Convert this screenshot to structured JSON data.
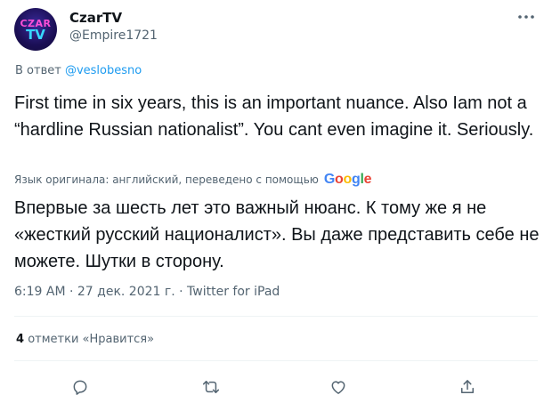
{
  "author": {
    "avatar_text_top": "CZAR",
    "avatar_text_bottom": "TV",
    "display_name": "CzarTV",
    "handle": "@Empire1721"
  },
  "reply": {
    "prefix": "В ответ",
    "mention": "@veslobesno"
  },
  "tweet": {
    "text": "First time in six years, this is an important nuance. Also Iam not a “hardline Russian nationalist”. You cant even imagine it. Seriously.",
    "translation_note": "Язык оригинала: английский, переведено с помощью",
    "translation_provider": "Google",
    "translated_text": "Впервые за шесть лет это важный нюанс. К тому же я не «жесткий русский националист». Вы даже представить себе не можете. Шутки в сторону.",
    "meta": "6:19 AM · 27 дек. 2021 г. · Twitter for iPad"
  },
  "stats": {
    "likes_count": "4",
    "likes_label": "отметки «Нравится»"
  },
  "icons": {
    "more": "more-horizontal-icon",
    "reply": "reply-bubble-icon",
    "retweet": "retweet-icon",
    "like": "heart-icon",
    "share": "share-icon"
  },
  "colors": {
    "text": "#0f1419",
    "secondary": "#536471",
    "accent": "#1d9bf0",
    "divider": "#eff3f4"
  }
}
